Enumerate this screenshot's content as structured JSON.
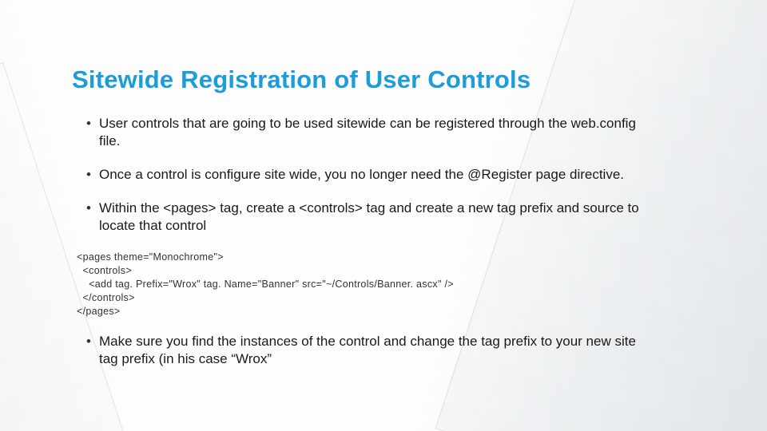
{
  "title": "Sitewide Registration of User Controls",
  "bullets_top": [
    "User controls that are going to be used sitewide can be registered through the web.config file.",
    "Once a control is configure site wide, you no longer need the @Register page directive.",
    "Within the <pages> tag, create a <controls> tag and create a new tag prefix and source to locate that control"
  ],
  "code": "<pages theme=\"Monochrome\">\n  <controls>\n    <add tag. Prefix=\"Wrox\" tag. Name=\"Banner\" src=\"~/Controls/Banner. ascx\" />\n  </controls>\n</pages>",
  "bullets_bottom": [
    "Make sure you find the instances of the control and change the tag prefix to your new site tag prefix (in his case “Wrox”"
  ]
}
